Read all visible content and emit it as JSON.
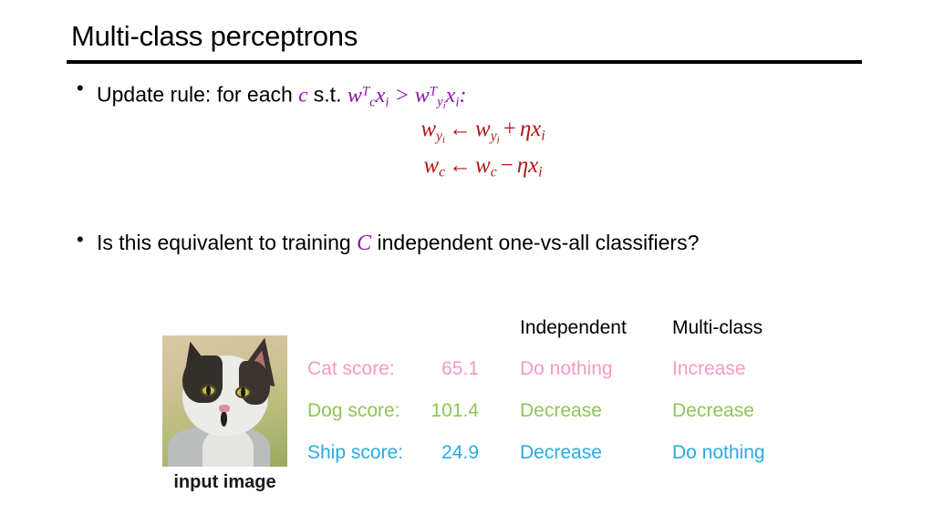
{
  "slide": {
    "title": "Multi-class perceptrons"
  },
  "bullets": {
    "update_rule": {
      "marker": "•",
      "lead": "Update rule: for each ",
      "var_c": "c",
      "mid": " s.t. ",
      "formula_w_left": "w",
      "formula_sub_c": "c",
      "formula_sup_T": "T",
      "formula_x": "x",
      "formula_sub_i": "i",
      "formula_gt": ">",
      "formula_sub_yi_y": "y",
      "formula_sub_yi_i": "i",
      "trail": ":"
    },
    "equations": [
      {
        "lhs_w": "w",
        "lhs_sub_y": "y",
        "lhs_sub_i": "i",
        "arrow": "←",
        "rhs_w": "w",
        "rhs_sub_y": "y",
        "rhs_sub_i": "i",
        "op": "+",
        "eta": "η",
        "x": "x",
        "x_sub": "i"
      },
      {
        "lhs_w": "w",
        "lhs_sub_y": "c",
        "lhs_sub_i": "",
        "arrow": "←",
        "rhs_w": "w",
        "rhs_sub_y": "c",
        "rhs_sub_i": "",
        "op": "−",
        "eta": "η",
        "x": "x",
        "x_sub": "i"
      }
    ],
    "equivalence": {
      "marker": "•",
      "lead": "Is this equivalent to training ",
      "var_C": "C",
      "trail": " independent one-vs-all classifiers?"
    }
  },
  "image": {
    "caption": "input image",
    "alt_name": "cat-photo"
  },
  "table": {
    "headers": {
      "independent": "Independent",
      "multiclass": "Multi-class"
    },
    "rows": [
      {
        "label": "Cat score:",
        "value": "65.1",
        "independent": "Do nothing",
        "multiclass": "Increase",
        "color": "#F49AC1"
      },
      {
        "label": "Dog score:",
        "value": "101.4",
        "independent": "Decrease",
        "multiclass": "Decrease",
        "color": "#8FC552"
      },
      {
        "label": "Ship score:",
        "value": "24.9",
        "independent": "Decrease",
        "multiclass": "Do nothing",
        "color": "#29ABE2"
      }
    ]
  },
  "colors": {
    "purple_math": "#8E14A8",
    "red_equation": "#B01818",
    "text_black": "#000000",
    "background": "#FFFFFF",
    "cat_pink": "#F49AC1",
    "dog_green": "#8FC552",
    "ship_blue": "#29ABE2"
  }
}
